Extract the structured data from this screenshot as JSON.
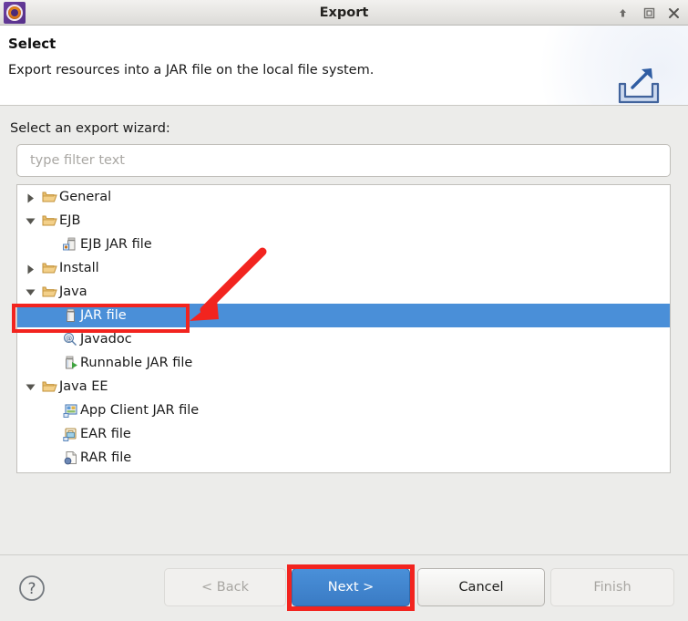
{
  "window": {
    "title": "Export",
    "app_icon": "eclipse-icon",
    "controls": [
      {
        "name": "shade-button",
        "icon": "arrow-up-icon"
      },
      {
        "name": "maximize-button",
        "icon": "maximize-icon"
      },
      {
        "name": "close-button",
        "icon": "close-icon"
      }
    ]
  },
  "header": {
    "title": "Select",
    "description": "Export resources into a JAR file on the local file system.",
    "icon": "export-tray-arrow-icon"
  },
  "main": {
    "wizard_label": "Select an export wizard:",
    "filter": {
      "placeholder": "type filter text",
      "value": ""
    },
    "tree": [
      {
        "label": "General",
        "level": 0,
        "expanded": false,
        "icon": "folder-icon",
        "selected": false
      },
      {
        "label": "EJB",
        "level": 0,
        "expanded": true,
        "icon": "folder-icon",
        "selected": false
      },
      {
        "label": "EJB JAR file",
        "level": 1,
        "expanded": null,
        "icon": "ejb-jar-file-icon",
        "selected": false
      },
      {
        "label": "Install",
        "level": 0,
        "expanded": false,
        "icon": "folder-icon",
        "selected": false
      },
      {
        "label": "Java",
        "level": 0,
        "expanded": true,
        "icon": "folder-icon",
        "selected": false
      },
      {
        "label": "JAR file",
        "level": 1,
        "expanded": null,
        "icon": "jar-file-icon",
        "selected": true
      },
      {
        "label": "Javadoc",
        "level": 1,
        "expanded": null,
        "icon": "javadoc-icon",
        "selected": false
      },
      {
        "label": "Runnable JAR file",
        "level": 1,
        "expanded": null,
        "icon": "runnable-jar-file-icon",
        "selected": false
      },
      {
        "label": "Java EE",
        "level": 0,
        "expanded": true,
        "icon": "folder-icon",
        "selected": false
      },
      {
        "label": "App Client JAR file",
        "level": 1,
        "expanded": null,
        "icon": "app-client-jar-icon",
        "selected": false
      },
      {
        "label": "EAR file",
        "level": 1,
        "expanded": null,
        "icon": "ear-file-icon",
        "selected": false
      },
      {
        "label": "RAR file",
        "level": 1,
        "expanded": null,
        "icon": "rar-file-icon",
        "selected": false
      }
    ]
  },
  "footer": {
    "help_icon": "help-question-icon",
    "buttons": {
      "back": {
        "label": "< Back",
        "state": "disabled"
      },
      "next": {
        "label": "Next >",
        "state": "primary"
      },
      "cancel": {
        "label": "Cancel",
        "state": "normal"
      },
      "finish": {
        "label": "Finish",
        "state": "disabled"
      }
    }
  },
  "annotations": {
    "highlight_color": "#f2241f",
    "arrow": "red-arrow-pointing-to-jar-file",
    "boxes": [
      "jar-file-row",
      "next-button"
    ]
  },
  "colors": {
    "selection_blue": "#4a8fd8",
    "primary_button": "#3a7bc4",
    "annotation_red": "#f2241f",
    "window_chrome": "#ececea",
    "header_white": "#ffffff"
  }
}
